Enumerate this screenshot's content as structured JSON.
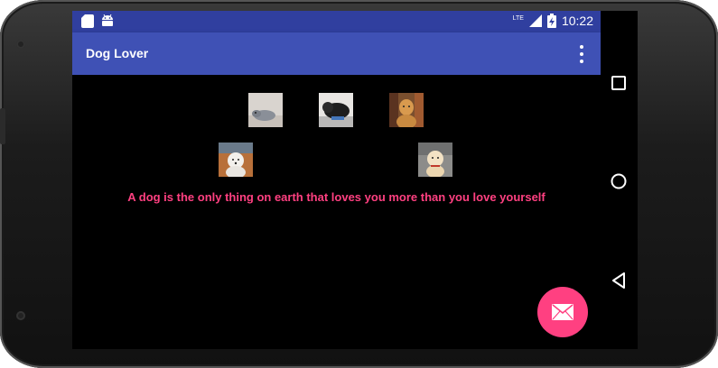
{
  "status_bar": {
    "time": "10:22",
    "network_label": "LTE",
    "icons": [
      "sd-card-icon",
      "android-icon",
      "lte-signal-icon",
      "battery-icon"
    ]
  },
  "app_bar": {
    "title": "Dog Lover",
    "menu_icon": "overflow-menu-icon",
    "color": "#3f51b5"
  },
  "gallery": {
    "images": [
      {
        "name": "dog-image-1",
        "desc": "grey dog lying down"
      },
      {
        "name": "dog-image-2",
        "desc": "black dog lying down"
      },
      {
        "name": "dog-image-3",
        "desc": "golden retriever"
      },
      {
        "name": "dog-image-4",
        "desc": "white westie"
      },
      {
        "name": "dog-image-5",
        "desc": "golden puppy"
      }
    ]
  },
  "quote": {
    "text": "A dog is the only thing on earth that loves you more than you love yourself",
    "color": "#ff4081"
  },
  "fab": {
    "icon": "mail-icon",
    "color": "#ff4081"
  },
  "nav_bar": {
    "icons": [
      "recents-icon",
      "home-icon",
      "back-icon"
    ]
  }
}
